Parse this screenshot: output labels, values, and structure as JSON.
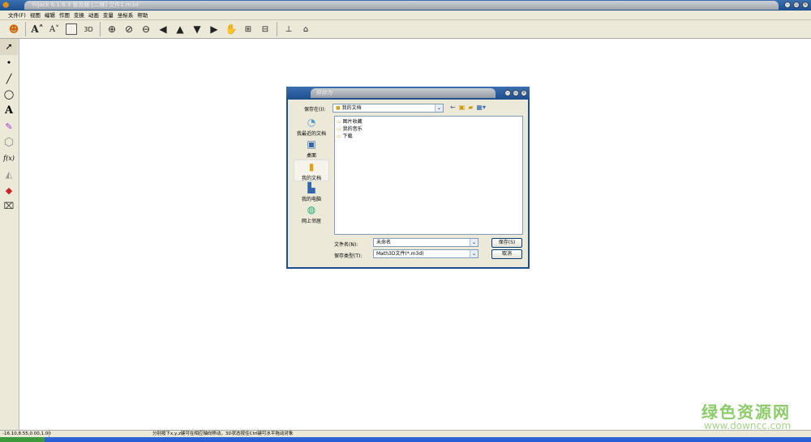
{
  "window": {
    "title": "hijack 6.1.6.3 普及版 [二维] 文件1.m3d",
    "controls": [
      "minimize",
      "restore",
      "close"
    ]
  },
  "menu": [
    "文件(F)",
    "视图",
    "编辑",
    "作图",
    "变换",
    "动画",
    "变量",
    "坐标系",
    "帮助"
  ],
  "toolbar": [
    "logo-icon",
    "font-larger-icon",
    "font-smaller-icon",
    "frame-icon",
    "3d-glasses-icon",
    "zoom-in-icon",
    "zoom-reset-icon",
    "zoom-out-icon",
    "arrow-left-icon",
    "arrow-up-icon",
    "arrow-down-icon",
    "arrow-right-icon",
    "hand-icon",
    "add-box-icon",
    "remove-box-icon",
    "hierarchy-icon",
    "cap-icon"
  ],
  "left_tools": [
    {
      "icon": "pointer-icon",
      "glyph": "➚"
    },
    {
      "icon": "point-icon",
      "glyph": "•"
    },
    {
      "icon": "line-icon",
      "glyph": "╱"
    },
    {
      "icon": "circle-icon",
      "glyph": "◯"
    },
    {
      "icon": "text-icon",
      "glyph": "A"
    },
    {
      "icon": "pencil-icon",
      "glyph": "✎"
    },
    {
      "icon": "polygon-icon",
      "glyph": "⬡"
    },
    {
      "icon": "function-icon",
      "glyph": "f(x)"
    },
    {
      "icon": "solid-icon",
      "glyph": "◭"
    },
    {
      "icon": "color-icon",
      "glyph": "◆"
    },
    {
      "icon": "trash-icon",
      "glyph": "🗑"
    }
  ],
  "dialog": {
    "title": "另存为",
    "save_in_label": "保存在(I):",
    "save_in_value": "我的文档",
    "places": [
      "我最近的文档",
      "桌面",
      "我的文档",
      "我的电脑",
      "网上邻居"
    ],
    "files": [
      "图片收藏",
      "我的音乐",
      "下载"
    ],
    "filename_label": "文件名(N):",
    "filename_value": "未命名",
    "filetype_label": "保存类型(T):",
    "filetype_value": "Math3D文件(*.m3d)",
    "save_button": "保存(S)",
    "cancel_button": "取消"
  },
  "status": {
    "coords": "-16.10,8.55,0.00,1.00",
    "hint": "分别按下x,y,z键可在相应轴向移动，3D状态按住Ctrl键可水平拖动对象"
  },
  "watermark": {
    "line1": "绿色资源网",
    "line2": "www.downcc.com"
  },
  "colors": {
    "title_blue": "#1d4f8f",
    "chrome": "#ece9d8"
  }
}
